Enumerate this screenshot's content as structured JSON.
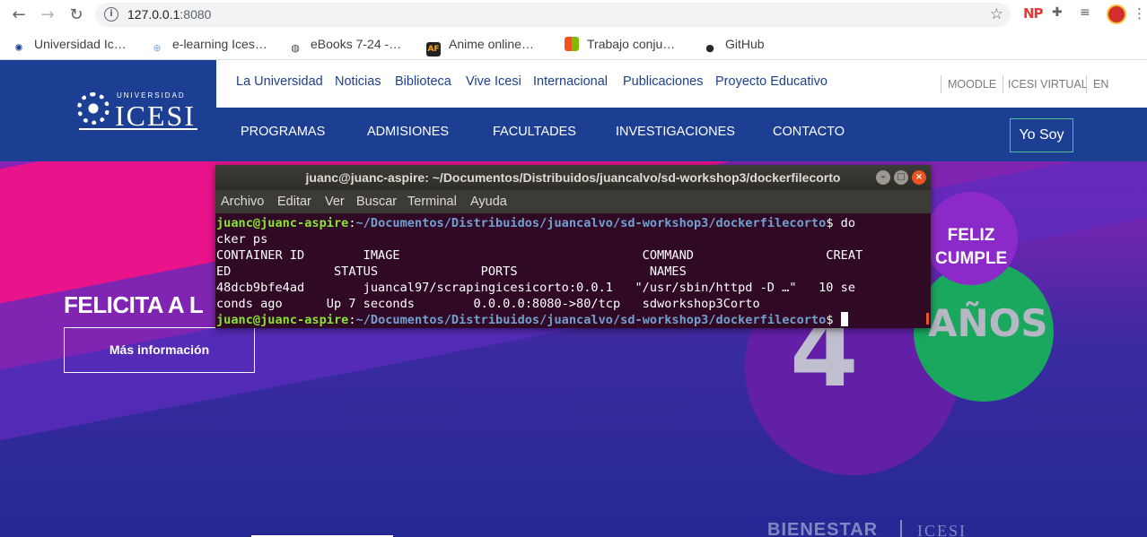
{
  "browser": {
    "url_host": "127.0.0.1",
    "url_port": ":8080",
    "back_glyph": "←",
    "forward_glyph": "→",
    "reload_glyph": "↻",
    "info_glyph": "i",
    "star_glyph": "☆",
    "ext_np": "NP",
    "puzzle_glyph": "✚",
    "queue_glyph": "≡",
    "menu_glyph": "⋮",
    "bookmarks": [
      {
        "label": "Universidad Ic…",
        "icon": "icesi-wheel-icon",
        "glyph": "✺",
        "color": "#1c3f94"
      },
      {
        "label": "e-learning Ices…",
        "icon": "elearning-icon",
        "glyph": "⊕",
        "color": "#7fa9d6"
      },
      {
        "label": "eBooks 7-24 -…",
        "icon": "globe-icon",
        "glyph": "◍",
        "color": "#3c4043"
      },
      {
        "label": "Anime online…",
        "icon": "animeflv-icon",
        "glyph": "AF",
        "color": "#222222"
      },
      {
        "label": "Trabajo conju…",
        "icon": "microsoft-icon",
        "glyph": "▦",
        "color": "#f25022"
      },
      {
        "label": "GitHub",
        "icon": "github-icon",
        "glyph": "●",
        "color": "#24292e"
      }
    ]
  },
  "site": {
    "logo_small": "UNIVERSIDAD",
    "logo_name": "ICESI",
    "topnav": [
      "La Universidad",
      "Noticias",
      "Biblioteca",
      "Vive Icesi",
      "Internacional",
      "Publicaciones",
      "Proyecto Educativo"
    ],
    "utils": [
      "MOODLE",
      "ICESI VIRTUAL",
      "EN"
    ],
    "mainnav": [
      "PROGRAMAS",
      "ADMISIONES",
      "FACULTADES",
      "INVESTIGACIONES",
      "CONTACTO"
    ],
    "yo_soy": "Yo Soy",
    "hero_title": "FELICITA A L",
    "hero_button": "Más información",
    "feliz": "FELIZ",
    "cumple": "CUMPLE",
    "anos": "AÑOS",
    "four": "4",
    "footer_left": "BIENESTAR",
    "footer_right": "ICESI"
  },
  "terminal": {
    "title": "juanc@juanc-aspire: ~/Documentos/Distribuidos/juancalvo/sd-workshop3/dockerfilecorto",
    "menu": [
      "Archivo",
      "Editar",
      "Ver",
      "Buscar",
      "Terminal",
      "Ayuda"
    ],
    "prompt_user": "juanc@juanc-aspire",
    "prompt_path": "~/Documentos/Distribuidos/juancalvo/sd-workshop3/dockerfilecorto",
    "cmd1": "$ do",
    "cmd1_wrap": "cker ps",
    "header1": "CONTAINER ID        IMAGE                                 COMMAND                  CREAT",
    "header2": "ED              STATUS              PORTS                  NAMES",
    "row1": "48dcb9bfe4ad        juancal97/scrapingicesicorto:0.0.1   \"/usr/sbin/httpd -D …\"   10 se",
    "row2": "conds ago      Up 7 seconds        0.0.0.0:8080->80/tcp   sdworkshop3Corto",
    "prompt_end": "$ "
  }
}
